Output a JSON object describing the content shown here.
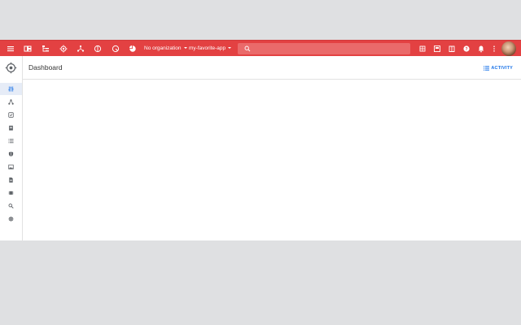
{
  "appbar": {
    "color": "#e34142",
    "icons": [
      "menu-icon",
      "dashboard-icon",
      "tree-icon",
      "hub-icon",
      "network-icon",
      "globe-icon",
      "gauge-icon",
      "pie-icon"
    ],
    "organization": "No organization",
    "project": "my-favorite-app",
    "search_placeholder": "",
    "right_icons": [
      "grid-icon",
      "console-icon",
      "book-icon",
      "help-icon",
      "notifications-icon",
      "more-vert-icon"
    ]
  },
  "sidebar": {
    "items": [
      {
        "icon": "tune-icon",
        "active": true
      },
      {
        "icon": "hierarchy-icon"
      },
      {
        "icon": "shield-check-icon"
      },
      {
        "icon": "clipboard-icon"
      },
      {
        "icon": "list-icon"
      },
      {
        "icon": "shield-icon"
      },
      {
        "icon": "image-icon"
      },
      {
        "icon": "file-icon"
      },
      {
        "icon": "chip-icon"
      },
      {
        "icon": "search-icon"
      },
      {
        "icon": "settings-icon"
      }
    ]
  },
  "header": {
    "title": "Dashboard",
    "activity_label": "ACTIVITY"
  }
}
